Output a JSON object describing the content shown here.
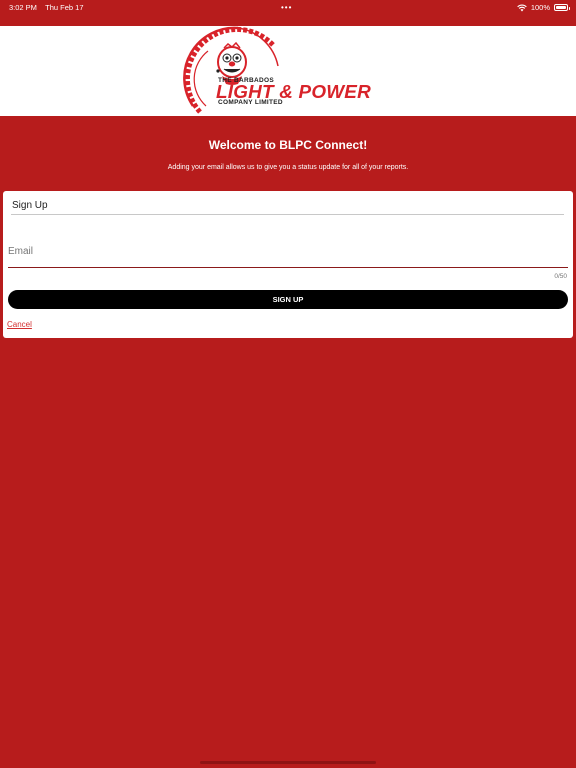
{
  "status_bar": {
    "time": "3:02 PM",
    "date": "Thu Feb 17",
    "dots": "•••",
    "battery_text": "100%",
    "wifi_icon": "wifi-icon",
    "battery_icon": "battery-icon"
  },
  "logo": {
    "line1": "THE BARBADOS",
    "line2": "LIGHT & POWER",
    "line3": "COMPANY LIMITED",
    "icon": "mascot-logo-icon",
    "brand_color": "#d8232a"
  },
  "welcome": {
    "title": "Welcome to BLPC Connect!",
    "subtitle": "Adding your email allows us to give you a status update for all of your reports."
  },
  "form": {
    "title": "Sign Up",
    "email_placeholder": "Email",
    "email_value": "",
    "char_counter": "0/50",
    "submit_label": "SIGN UP",
    "cancel_label": "Cancel"
  },
  "colors": {
    "background": "#b71c1c",
    "card": "#ffffff",
    "button": "#000000",
    "cancel": "#d32f2f"
  }
}
